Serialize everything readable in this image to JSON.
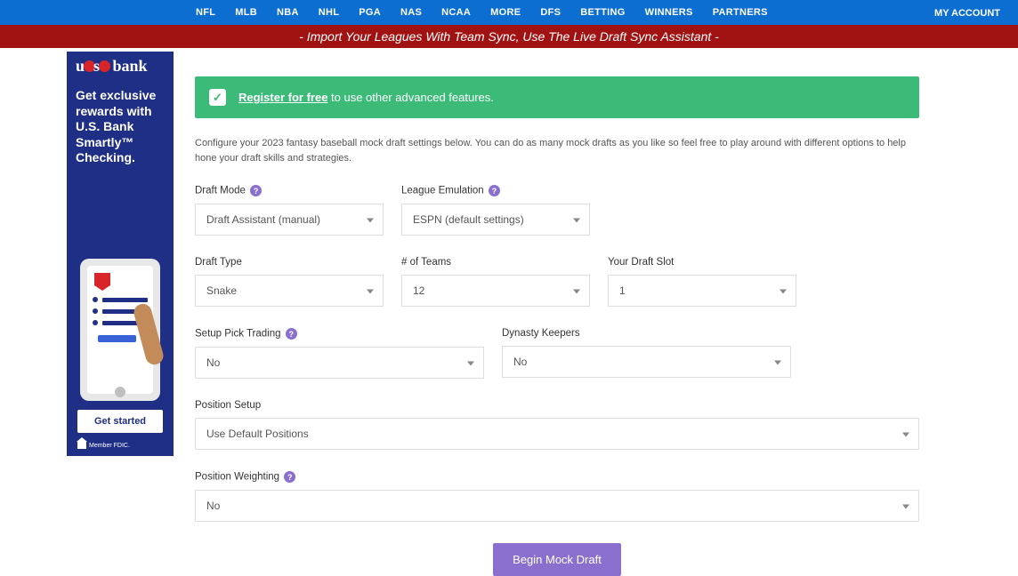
{
  "nav": {
    "items": [
      "NFL",
      "MLB",
      "NBA",
      "NHL",
      "PGA",
      "NAS",
      "NCAA",
      "MORE",
      "DFS",
      "BETTING",
      "WINNERS",
      "PARTNERS"
    ],
    "account": "MY ACCOUNT"
  },
  "redbar": "- Import Your Leagues With Team Sync, Use The Live Draft Sync Assistant -",
  "ad": {
    "brand": "bank",
    "text": "Get exclusive rewards with U.S. Bank Smartly™ Checking.",
    "cta": "Get started",
    "disclaim": "Member FDIC."
  },
  "banner": {
    "link": "Register for free",
    "rest": " to use other advanced features."
  },
  "intro": "Configure your 2023 fantasy baseball mock draft settings below. You can do as many mock drafts as you like so feel free to play around with different options to help hone your draft skills and strategies.",
  "form": {
    "draftMode": {
      "label": "Draft Mode",
      "value": "Draft Assistant (manual)"
    },
    "leagueEmu": {
      "label": "League Emulation",
      "value": "ESPN (default settings)"
    },
    "draftType": {
      "label": "Draft Type",
      "value": "Snake"
    },
    "numTeams": {
      "label": "# of Teams",
      "value": "12"
    },
    "draftSlot": {
      "label": "Your Draft Slot",
      "value": "1"
    },
    "pickTrading": {
      "label": "Setup Pick Trading",
      "value": "No"
    },
    "dynasty": {
      "label": "Dynasty Keepers",
      "value": "No"
    },
    "positionSetup": {
      "label": "Position Setup",
      "value": "Use Default Positions"
    },
    "positionWeight": {
      "label": "Position Weighting",
      "value": "No"
    },
    "submit": "Begin Mock Draft"
  }
}
